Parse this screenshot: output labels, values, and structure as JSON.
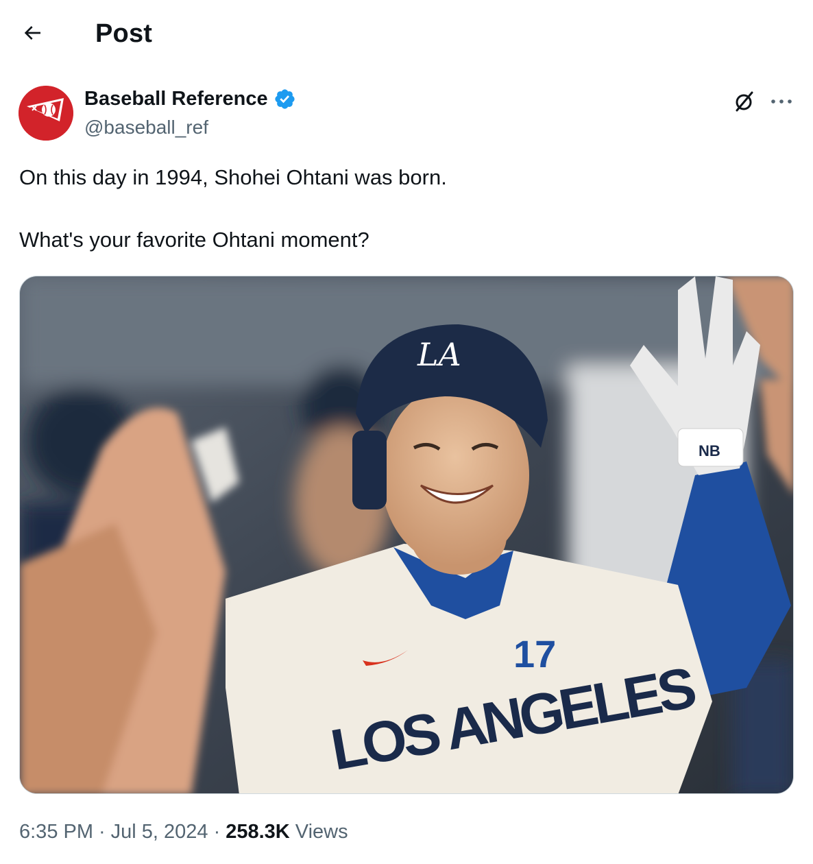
{
  "header": {
    "title": "Post",
    "back_icon": "arrow-left-icon"
  },
  "author": {
    "name": "Baseball Reference",
    "handle": "@baseball_ref",
    "verified": true,
    "avatar_color": "#d2232a",
    "verified_color": "#1d9bf0"
  },
  "actions": {
    "grok_icon": "slashed-circle-icon",
    "more_icon": "more-dots-icon"
  },
  "post": {
    "line1": "On this day in 1994, Shohei Ohtani was born.",
    "line2": "What's your favorite Ohtani moment?",
    "media_icon": "photo-ohtani-high-five",
    "jersey_text": "LOS ANGELES",
    "jersey_number": "17"
  },
  "meta": {
    "time": "6:35 PM",
    "separator": "·",
    "date": "Jul 5, 2024",
    "views_count": "258.3K",
    "views_label": "Views"
  },
  "colors": {
    "text_primary": "#0f1419",
    "text_secondary": "#536471",
    "border": "#cfd9de"
  }
}
